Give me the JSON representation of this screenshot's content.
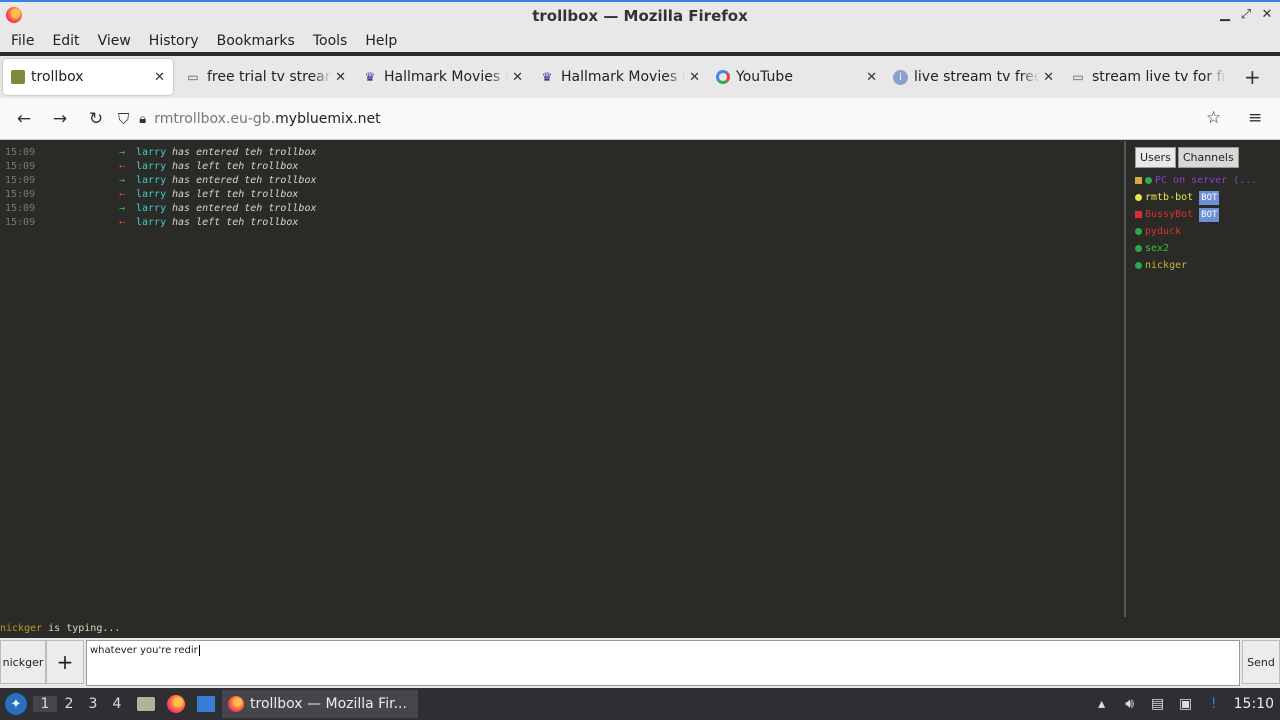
{
  "window": {
    "title": "trollbox — Mozilla Firefox"
  },
  "menu": [
    {
      "label": "File",
      "u": "F",
      "rest": "ile"
    },
    {
      "label": "Edit",
      "u": "E",
      "rest": "dit"
    },
    {
      "label": "View",
      "u": "V",
      "rest": "iew"
    },
    {
      "label": "History",
      "u": "",
      "rest": "History"
    },
    {
      "label": "Bookmarks",
      "u": "B",
      "rest": "ookmarks"
    },
    {
      "label": "Tools",
      "u": "T",
      "rest": "ools"
    },
    {
      "label": "Help",
      "u": "H",
      "rest": "elp"
    }
  ],
  "tabs": [
    {
      "label": "trollbox",
      "active": true,
      "icon": "trollbox-favicon"
    },
    {
      "label": "free trial tv streaming",
      "icon": "page-icon"
    },
    {
      "label": "Hallmark Movies Now",
      "icon": "hallmark-crown-icon"
    },
    {
      "label": "Hallmark Movies Now",
      "icon": "hallmark-crown-icon"
    },
    {
      "label": "YouTube",
      "icon": "google-icon"
    },
    {
      "label": "live stream tv free",
      "icon": "info-icon"
    },
    {
      "label": "stream live tv for free",
      "icon": "page-icon"
    }
  ],
  "nav": {
    "url_prefix": "rmtrollbox.eu-gb.",
    "url_domain": "mybluemix.net"
  },
  "chat": {
    "messages": [
      {
        "time": "15:09",
        "dir": "in",
        "user": "larry",
        "text": "has entered teh trollbox"
      },
      {
        "time": "15:09",
        "dir": "out",
        "user": "larry",
        "text": "has left teh trollbox"
      },
      {
        "time": "15:09",
        "dir": "in",
        "user": "larry",
        "text": "has entered teh trollbox"
      },
      {
        "time": "15:09",
        "dir": "out",
        "user": "larry",
        "text": "has left teh trollbox"
      },
      {
        "time": "15:09",
        "dir": "in",
        "user": "larry",
        "text": "has entered teh trollbox"
      },
      {
        "time": "15:09",
        "dir": "out",
        "user": "larry",
        "text": "has left teh trollbox"
      }
    ],
    "arrow_in": "→",
    "arrow_out": "←"
  },
  "sidebar": {
    "tab_users": "Users",
    "tab_channels": "Channels",
    "users": [
      {
        "name": "PC on server (...",
        "color": "#8a3fd1",
        "dot": "#2fa84f",
        "prefix_icon": true,
        "bot": ""
      },
      {
        "name": "rmtb-bot",
        "color": "#e8e84a",
        "dot": "#e8e84a",
        "bot": "BOT"
      },
      {
        "name": "BussyBot",
        "color": "#d93030",
        "dot": "#d93030",
        "bot": "BOT",
        "square": true
      },
      {
        "name": "pyduck",
        "color": "#d93030",
        "dot": "#2fa84f",
        "bot": ""
      },
      {
        "name": "sex2",
        "color": "#3bbf3b",
        "dot": "#2fa84f",
        "bot": ""
      },
      {
        "name": "nickger",
        "color": "#c8b23c",
        "dot": "#2fa84f",
        "bot": ""
      }
    ]
  },
  "typing": {
    "name": "nickger",
    "text": "is typing..."
  },
  "input": {
    "nick_label": "nickger",
    "plus_label": "+",
    "value": "whatever you're redir",
    "send_label": "Send"
  },
  "taskbar": {
    "workspaces": [
      "1",
      "2",
      "3",
      "4"
    ],
    "task_label": "trollbox — Mozilla Fir...",
    "clock": "15:10"
  }
}
